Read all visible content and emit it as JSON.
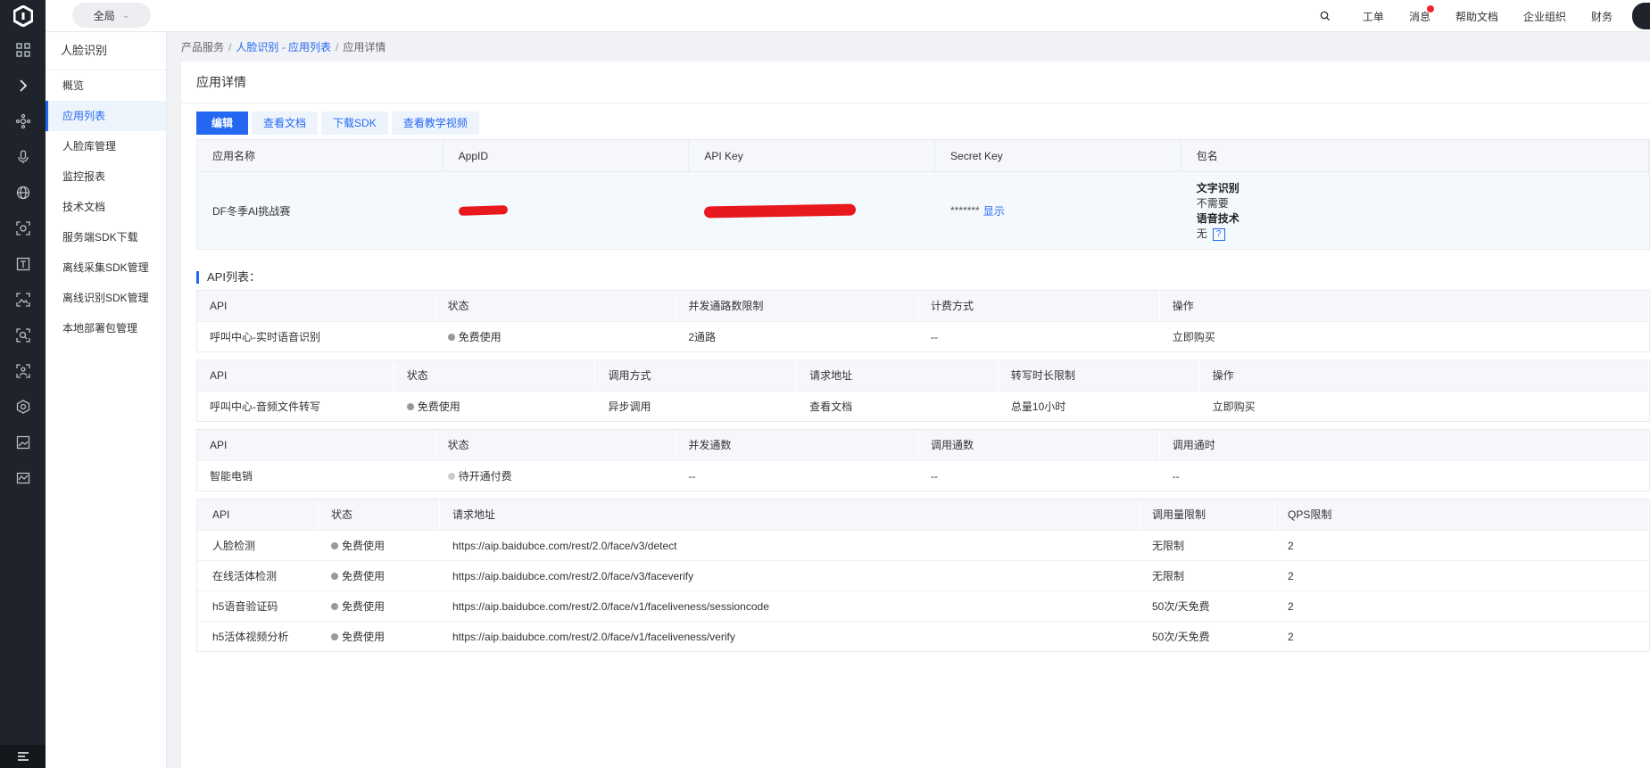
{
  "topbar": {
    "region": "全局",
    "nav": [
      "工单",
      "消息",
      "帮助文档",
      "企业组织",
      "财务"
    ]
  },
  "sidebar": {
    "title": "人脸识别",
    "items": [
      "概览",
      "应用列表",
      "人脸库管理",
      "监控报表",
      "技术文档",
      "服务端SDK下载",
      "离线采集SDK管理",
      "离线识别SDK管理",
      "本地部署包管理"
    ],
    "active_index": 1
  },
  "breadcrumb": {
    "root": "产品服务",
    "parent": "人脸识别 - 应用列表",
    "current": "应用详情"
  },
  "page": {
    "title": "应用详情",
    "buttons": {
      "edit": "编辑",
      "docs": "查看文档",
      "sdk": "下载SDK",
      "video": "查看教学视频"
    }
  },
  "app_info": {
    "headers": [
      "应用名称",
      "AppID",
      "API Key",
      "Secret Key",
      "包名"
    ],
    "name": "DF冬季AI挑战赛",
    "secret_mask": "*******",
    "secret_show": "显示",
    "package": {
      "label1": "文字识别",
      "value1": "不需要",
      "label2": "语音技术",
      "value2": "无",
      "help": "?"
    }
  },
  "api_section_title": "API列表：",
  "table1": {
    "headers": [
      "API",
      "状态",
      "并发通路数限制",
      "计费方式",
      "操作"
    ],
    "row": [
      "呼叫中心-实时语音识别",
      "免费使用",
      "2通路",
      "--",
      "立即购买"
    ]
  },
  "table2": {
    "headers": [
      "API",
      "状态",
      "调用方式",
      "请求地址",
      "转写时长限制",
      "操作"
    ],
    "row": [
      "呼叫中心-音频文件转写",
      "免费使用",
      "异步调用",
      "查看文档",
      "总量10小时",
      "立即购买"
    ]
  },
  "table3": {
    "headers": [
      "API",
      "状态",
      "并发通数",
      "调用通数",
      "调用通时"
    ],
    "row": [
      "智能电销",
      "待开通付费",
      "--",
      "--",
      "--"
    ]
  },
  "table4": {
    "headers": [
      "API",
      "状态",
      "请求地址",
      "调用量限制",
      "QPS限制"
    ],
    "rows": [
      [
        "人脸检测",
        "免费使用",
        "https://aip.baidubce.com/rest/2.0/face/v3/detect",
        "无限制",
        "2"
      ],
      [
        "在线活体检测",
        "免费使用",
        "https://aip.baidubce.com/rest/2.0/face/v3/faceverify",
        "无限制",
        "2"
      ],
      [
        "h5语音验证码",
        "免费使用",
        "https://aip.baidubce.com/rest/2.0/face/v1/faceliveness/sessioncode",
        "50次/天免费",
        "2"
      ],
      [
        "h5活体视频分析",
        "免费使用",
        "https://aip.baidubce.com/rest/2.0/face/v1/faceliveness/verify",
        "50次/天免费",
        "2"
      ]
    ]
  }
}
